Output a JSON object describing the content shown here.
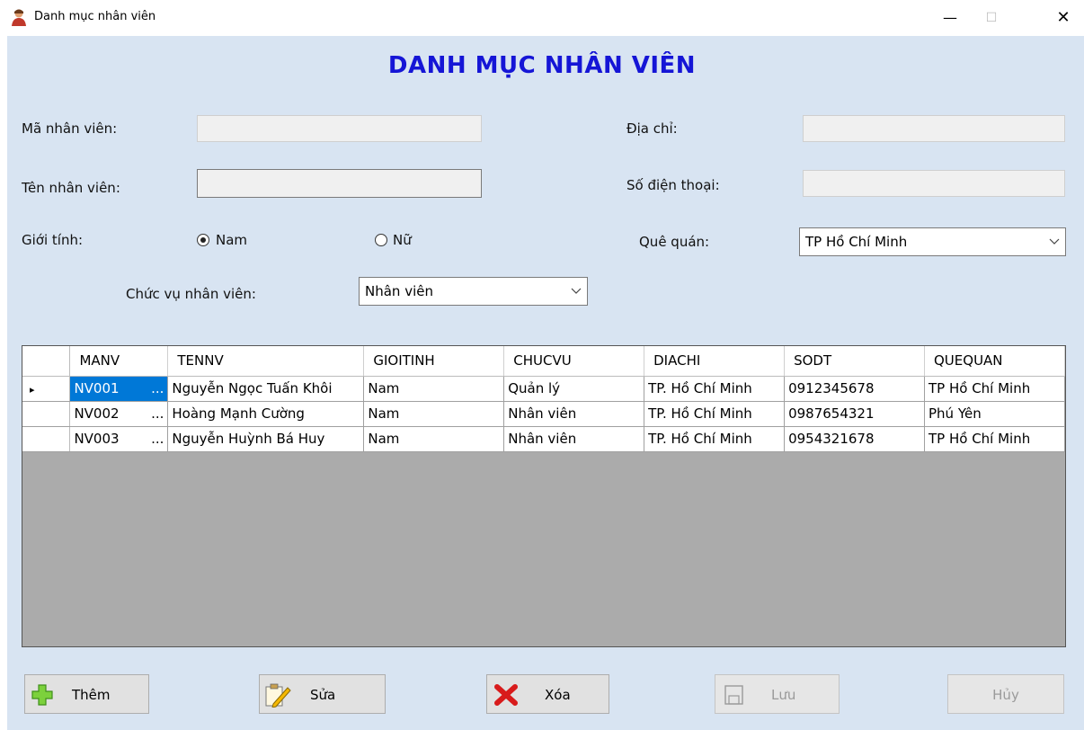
{
  "window": {
    "title": "Danh mục nhân viên",
    "minimize_glyph": "—",
    "maximize_glyph": "☐",
    "close_glyph": "✕"
  },
  "heading": "DANH MỤC NHÂN VIÊN",
  "form": {
    "ma_nv_label": "Mã nhân viên:",
    "ma_nv_value": "",
    "ten_nv_label": "Tên nhân viên:",
    "ten_nv_value": "",
    "gioi_tinh_label": "Giới tính:",
    "gender_options": [
      {
        "label": "Nam",
        "checked": true
      },
      {
        "label": "Nữ",
        "checked": false
      }
    ],
    "chuc_vu_label": "Chức vụ nhân viên:",
    "chuc_vu_value": "Nhân viên",
    "dia_chi_label": "Địa chỉ:",
    "dia_chi_value": "",
    "sdt_label": "Số điện thoại:",
    "sdt_value": "",
    "que_quan_label": "Quê quán:",
    "que_quan_value": "TP Hồ Chí Minh"
  },
  "grid": {
    "columns": [
      "MANV",
      "TENNV",
      "GIOITINH",
      "CHUCVU",
      "DIACHI",
      "SODT",
      "QUEQUAN"
    ],
    "rows": [
      {
        "manv": "NV001",
        "tennv": "Nguyễn Ngọc Tuấn Khôi",
        "gioitinh": "Nam",
        "chucvu": "Quản lý",
        "diachi": "TP. Hồ Chí Minh",
        "sodt": "0912345678",
        "quequan": "TP Hồ Chí Minh",
        "current": true
      },
      {
        "manv": "NV002",
        "tennv": "Hoàng Mạnh Cường",
        "gioitinh": "Nam",
        "chucvu": "Nhân viên",
        "diachi": "TP. Hồ Chí Minh",
        "sodt": "0987654321",
        "quequan": "Phú Yên",
        "current": false
      },
      {
        "manv": "NV003",
        "tennv": "Nguyễn Huỳnh Bá Huy",
        "gioitinh": "Nam",
        "chucvu": "Nhân viên",
        "diachi": "TP. Hồ Chí Minh",
        "sodt": "0954321678",
        "quequan": "TP Hồ Chí Minh",
        "current": false
      }
    ],
    "ellipsis": "...",
    "current_row_marker": "▸"
  },
  "buttons": {
    "them": "Thêm",
    "sua": "Sửa",
    "xoa": "Xóa",
    "luu": "Lưu",
    "huy": "Hủy"
  },
  "colors": {
    "heading": "#1515d6",
    "client_bg": "#d8e4f2",
    "selection": "#0078d7",
    "grid_empty": "#ababab"
  }
}
